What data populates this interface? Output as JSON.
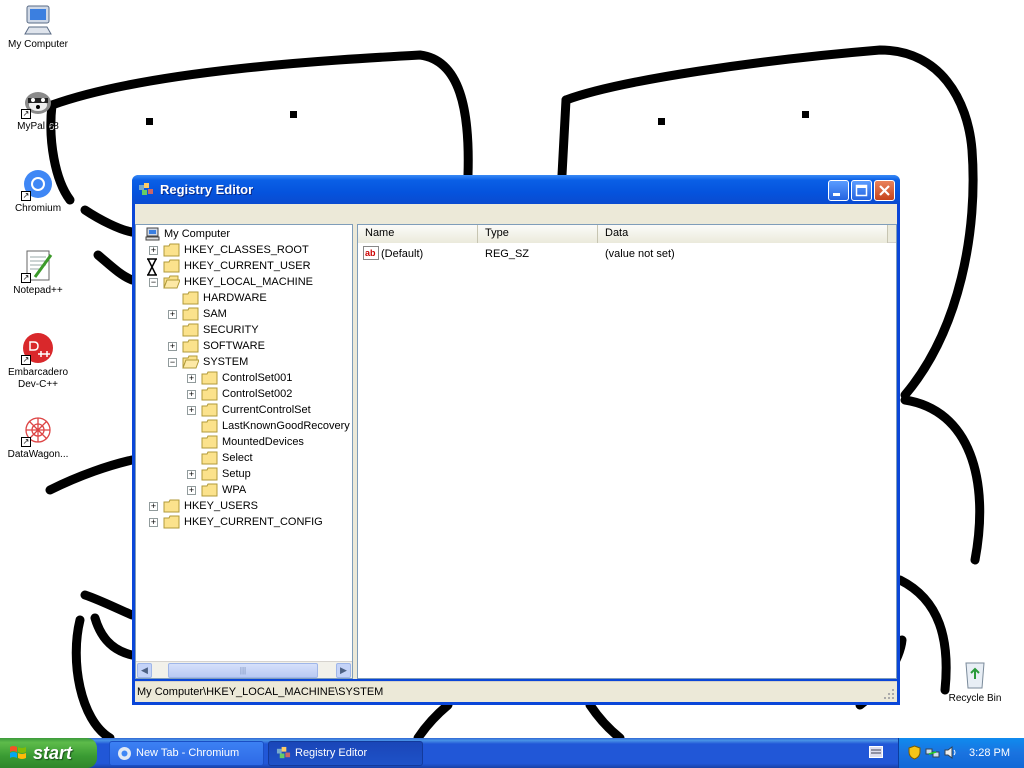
{
  "desktop": {
    "icons": [
      {
        "label": "My Computer",
        "icon": "my-computer-icon"
      },
      {
        "label": "MyPal 68",
        "icon": "mypal-raccoon-icon"
      },
      {
        "label": "Chromium",
        "icon": "chromium-icon"
      },
      {
        "label": "Notepad++",
        "icon": "notepad-plus-plus-icon"
      },
      {
        "label": "Embarcadero Dev-C++",
        "icon": "devcpp-icon"
      },
      {
        "label": "DataWagon...",
        "icon": "datawagon-icon"
      },
      {
        "label": "Recycle Bin",
        "icon": "recycle-bin-icon"
      }
    ]
  },
  "window": {
    "title": "Registry Editor",
    "tree": {
      "root": "My Computer",
      "hkcr": "HKEY_CLASSES_ROOT",
      "hkcu": "HKEY_CURRENT_USER",
      "hklm": "HKEY_LOCAL_MACHINE",
      "hardware": "HARDWARE",
      "sam": "SAM",
      "security": "SECURITY",
      "software": "SOFTWARE",
      "system": "SYSTEM",
      "controlset001": "ControlSet001",
      "controlset002": "ControlSet002",
      "currentcontrolset": "CurrentControlSet",
      "lastknowngood": "LastKnownGoodRecovery",
      "mounteddevices": "MountedDevices",
      "select": "Select",
      "setup": "Setup",
      "wpa": "WPA",
      "hku": "HKEY_USERS",
      "hkcc": "HKEY_CURRENT_CONFIG"
    },
    "list": {
      "columns": {
        "name": "Name",
        "type": "Type",
        "data": "Data"
      },
      "rows": [
        {
          "name": "(Default)",
          "type": "REG_SZ",
          "data": "(value not set)"
        }
      ]
    },
    "status": "My Computer\\HKEY_LOCAL_MACHINE\\SYSTEM"
  },
  "taskbar": {
    "start_label": "start",
    "tasks": [
      {
        "label": "New Tab - Chromium",
        "icon": "chromium-icon"
      },
      {
        "label": "Registry Editor",
        "icon": "regedit-icon"
      }
    ],
    "clock": "3:28 PM"
  },
  "colors": {
    "title_bar": "#0553dd",
    "taskbar": "#2157d7",
    "start_button": "#3a9b33"
  }
}
